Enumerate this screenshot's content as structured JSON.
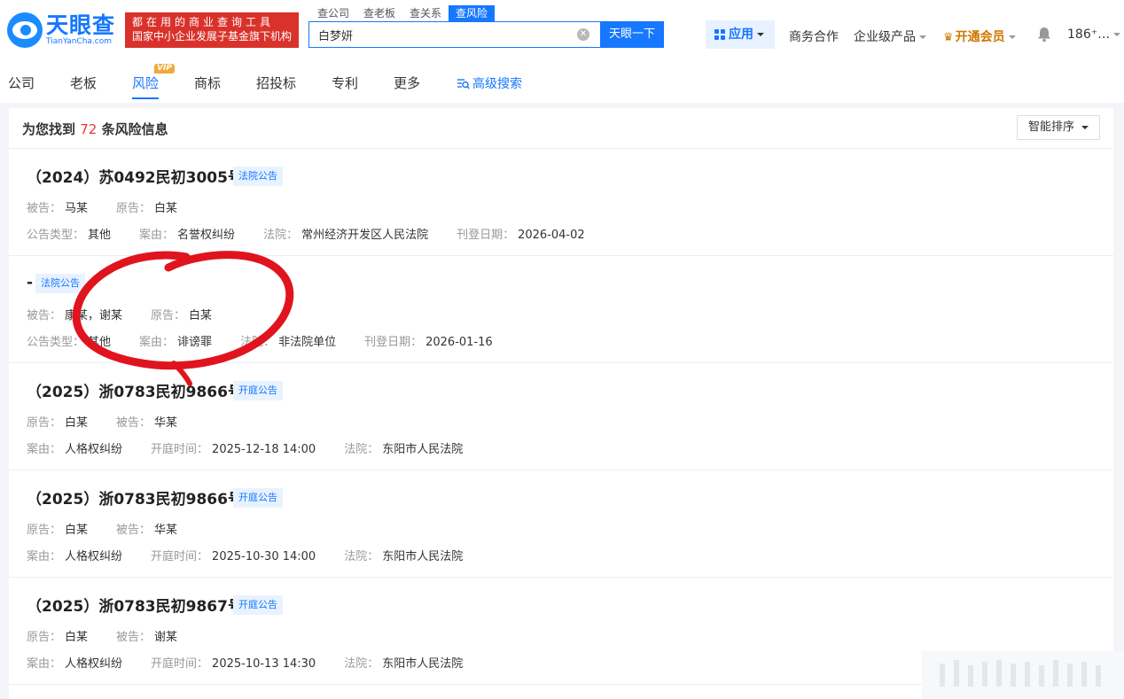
{
  "header": {
    "logo_cn": "天眼查",
    "logo_en": "TianYanCha.com",
    "slogan_line1": "都在用的商业查询工具",
    "slogan_line2": "国家中小企业发展子基金旗下机构",
    "search_tabs": [
      "查公司",
      "查老板",
      "查关系",
      "查风险"
    ],
    "search_value": "白梦妍",
    "search_button": "天眼一下",
    "app_button": "应用",
    "business": "商务合作",
    "enterprise": "企业级产品",
    "vip": "开通会员",
    "user": "186⁺…",
    "colors": {
      "accent": "#1677ff",
      "slogan_bg": "#d9322b",
      "vip": "#d07600"
    }
  },
  "nav": {
    "items": [
      "公司",
      "老板",
      "风险",
      "商标",
      "招投标",
      "专利",
      "更多"
    ],
    "vip_badge": "VIP",
    "advanced": "高级搜索"
  },
  "results": {
    "prefix": "为您找到",
    "count": "72",
    "suffix": "条风险信息",
    "sort": "智能排序"
  },
  "records": [
    {
      "title": "（2024）苏0492民初3005号",
      "tag": "法院公告",
      "row1": [
        {
          "label": "被告：",
          "value": "马某"
        },
        {
          "label": "原告：",
          "value": "白某"
        }
      ],
      "row2": [
        {
          "label": "公告类型：",
          "value": "其他"
        },
        {
          "label": "案由：",
          "value": "名誉权纠纷"
        },
        {
          "label": "法院：",
          "value": "常州经济开发区人民法院"
        },
        {
          "label": "刊登日期：",
          "value": "2026-04-02"
        }
      ]
    },
    {
      "title": "-",
      "tag": "法院公告",
      "row1": [
        {
          "label": "被告：",
          "value": "康某，谢某"
        },
        {
          "label": "原告：",
          "value": "白某"
        }
      ],
      "row2": [
        {
          "label": "公告类型：",
          "value": "其他"
        },
        {
          "label": "案由：",
          "value": "诽谤罪"
        },
        {
          "label": "法院：",
          "value": "非法院单位"
        },
        {
          "label": "刊登日期：",
          "value": "2026-01-16"
        }
      ]
    },
    {
      "title": "（2025）浙0783民初9866号",
      "tag": "开庭公告",
      "row1": [
        {
          "label": "原告：",
          "value": "白某"
        },
        {
          "label": "被告：",
          "value": "华某"
        }
      ],
      "row2": [
        {
          "label": "案由：",
          "value": "人格权纠纷"
        },
        {
          "label": "开庭时间：",
          "value": "2025-12-18 14:00"
        },
        {
          "label": "法院：",
          "value": "东阳市人民法院"
        }
      ]
    },
    {
      "title": "（2025）浙0783民初9866号",
      "tag": "开庭公告",
      "row1": [
        {
          "label": "原告：",
          "value": "白某"
        },
        {
          "label": "被告：",
          "value": "华某"
        }
      ],
      "row2": [
        {
          "label": "案由：",
          "value": "人格权纠纷"
        },
        {
          "label": "开庭时间：",
          "value": "2025-10-30 14:00"
        },
        {
          "label": "法院：",
          "value": "东阳市人民法院"
        }
      ]
    },
    {
      "title": "（2025）浙0783民初9867号",
      "tag": "开庭公告",
      "row1": [
        {
          "label": "原告：",
          "value": "白某"
        },
        {
          "label": "被告：",
          "value": "谢某"
        }
      ],
      "row2": [
        {
          "label": "案由：",
          "value": "人格权纠纷"
        },
        {
          "label": "开庭时间：",
          "value": "2025-10-13 14:30"
        },
        {
          "label": "法院：",
          "value": "东阳市人民法院"
        }
      ]
    }
  ]
}
